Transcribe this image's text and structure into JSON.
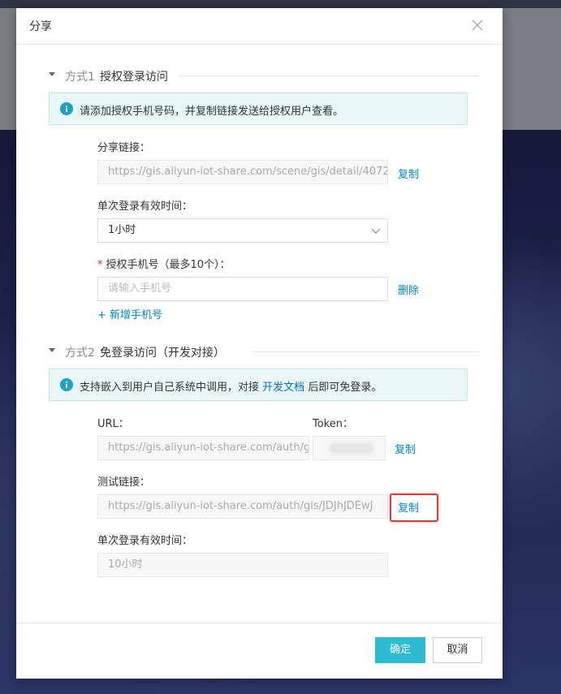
{
  "dialog": {
    "title": "分享"
  },
  "method1": {
    "number": "方式1",
    "title": "授权登录访问",
    "alert": "请添加授权手机号码，并复制链接发送给授权用户查看。",
    "share_link_label": "分享链接：",
    "share_link_value": "https://gis.aliyun-iot-share.com/scene/gis/detail/4072",
    "copy_label": "复制",
    "validity_label": "单次登录有效时间：",
    "validity_value": "1小时",
    "phone_label": "授权手机号（最多10个）：",
    "phone_placeholder": "请输入手机号",
    "delete_label": "删除",
    "add_phone_label": "+ 新增手机号"
  },
  "method2": {
    "number": "方式2",
    "title": "免登录访问（开发对接）",
    "alert_prefix": "支持嵌入到用户自己系统中调用，对接",
    "alert_link": "开发文档",
    "alert_suffix": "后即可免登录。",
    "url_label": "URL：",
    "url_value": "https://gis.aliyun-iot-share.com/auth/g",
    "token_label": "Token：",
    "copy_label": "复制",
    "test_link_label": "测试链接：",
    "test_link_value": "https://gis.aliyun-iot-share.com/auth/gis/JDJhJDEwJ",
    "test_copy_label": "复制",
    "validity_label": "单次登录有效时间：",
    "validity_value": "10小时"
  },
  "footer": {
    "confirm_label": "确定",
    "cancel_label": "取消"
  },
  "colors": {
    "primary": "#2dbbd4",
    "link": "#0088cc",
    "highlight": "#e53935"
  }
}
